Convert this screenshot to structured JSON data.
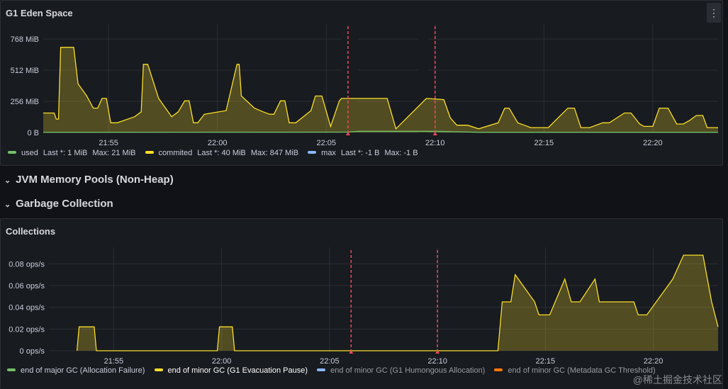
{
  "panels": {
    "eden": {
      "title": "G1 Eden Space",
      "menu_icon": "⋮",
      "legend": [
        {
          "name": "used",
          "color": "#73bf69",
          "last": "Last *: 1 MiB",
          "max": "Max: 21 MiB"
        },
        {
          "name": "commited",
          "color": "#fade2a",
          "last": "Last *: 40 MiB",
          "max": "Max: 847 MiB"
        },
        {
          "name": "max",
          "color": "#8ab8ff",
          "last": "Last *: -1 B",
          "max": "Max: -1 B"
        }
      ]
    },
    "collections": {
      "title": "Collections",
      "legend": [
        {
          "name": "end of major GC (Allocation Failure)",
          "color": "#73bf69"
        },
        {
          "name": "end of minor GC (G1 Evacuation Pause)",
          "color": "#fade2a"
        },
        {
          "name": "end of minor GC (G1 Humongous Allocation)",
          "color": "#8ab8ff"
        },
        {
          "name": "end of minor GC (Metadata GC Threshold)",
          "color": "#ff780a"
        }
      ]
    }
  },
  "rows": {
    "nonheap": {
      "title": "JVM Memory Pools (Non-Heap)",
      "chevron": "⌄"
    },
    "gc": {
      "title": "Garbage Collection",
      "chevron": "⌄"
    }
  },
  "watermark": "@稀土掘金技术社区",
  "chart_data": [
    {
      "type": "area",
      "title": "G1 Eden Space",
      "x_unit": "minutes since 21:52",
      "x_ticks": [
        "21:55",
        "22:00",
        "22:05",
        "22:10",
        "22:15",
        "22:20"
      ],
      "xlim": [
        "21:52",
        "22:23"
      ],
      "y_ticks": [
        "0 B",
        "256 MiB",
        "512 MiB",
        "768 MiB"
      ],
      "y_unit": "MiB",
      "ylim": [
        0,
        850
      ],
      "annotations_x": [
        "22:06",
        "22:10"
      ],
      "fill_between_annotations": "22:06 – 22:10",
      "series": [
        {
          "name": "commited",
          "color": "#fade2a",
          "x": [
            "21:52",
            "21:52:30",
            "21:52:36",
            "21:52:42",
            "21:52:48",
            "21:53:24",
            "21:53:36",
            "21:53:48",
            "21:54",
            "21:54:18",
            "21:54:30",
            "21:54:42",
            "21:54:54",
            "21:55:06",
            "21:55:24",
            "21:56:12",
            "21:56:30",
            "21:56:36",
            "21:56:48",
            "21:57:18",
            "21:57:54",
            "21:58:12",
            "21:58:30",
            "21:58:42",
            "21:58:54",
            "21:59:06",
            "21:59:24",
            "22:00:24",
            "22:00:54",
            "22:01",
            "22:01:06",
            "22:01:42",
            "22:02:06",
            "22:02:24",
            "22:02:36",
            "22:02:54",
            "22:03:06",
            "22:03:18",
            "22:03:36",
            "22:04:18",
            "22:04:30",
            "22:04:48",
            "22:05:12",
            "22:05:36",
            "22:05:42",
            "22:07:48",
            "22:08:12",
            "22:09:36",
            "22:10:24",
            "22:10:42",
            "22:11",
            "22:11:30",
            "22:12",
            "22:12:54",
            "22:13:12",
            "22:13:24",
            "22:13:48",
            "22:14:06",
            "22:14:24",
            "22:15:12",
            "22:16:06",
            "22:16:24",
            "22:16:42",
            "22:17:06",
            "22:17:42",
            "22:18",
            "22:18:42",
            "22:19",
            "22:19:24",
            "22:19:36",
            "22:20",
            "22:20:18",
            "22:20:42",
            "22:21:06",
            "22:21:24",
            "22:21:42",
            "22:22",
            "22:22:18",
            "22:22:30",
            "22:22:48",
            "22:23"
          ],
          "values": [
            160,
            160,
            110,
            110,
            700,
            700,
            400,
            350,
            300,
            200,
            200,
            280,
            280,
            80,
            80,
            130,
            170,
            560,
            560,
            280,
            130,
            170,
            260,
            260,
            80,
            80,
            150,
            180,
            560,
            560,
            300,
            200,
            170,
            150,
            150,
            260,
            260,
            80,
            80,
            180,
            300,
            300,
            50,
            260,
            280,
            280,
            30,
            280,
            270,
            120,
            60,
            60,
            30,
            80,
            200,
            200,
            80,
            60,
            40,
            40,
            200,
            200,
            40,
            40,
            80,
            80,
            160,
            160,
            70,
            50,
            50,
            200,
            200,
            70,
            70,
            100,
            140,
            140,
            40,
            40,
            40
          ]
        },
        {
          "name": "used",
          "color": "#73bf69",
          "x": [
            "21:52",
            "22:06",
            "22:06:30",
            "22:10",
            "22:12",
            "22:23"
          ],
          "values": [
            2,
            3,
            10,
            10,
            2,
            2
          ]
        }
      ]
    },
    {
      "type": "area",
      "title": "Collections",
      "x_unit": "minutes since 21:52",
      "x_ticks": [
        "21:55",
        "22:00",
        "22:05",
        "22:10",
        "22:15",
        "22:20"
      ],
      "xlim": [
        "21:52",
        "22:23"
      ],
      "y_ticks": [
        "0 ops/s",
        "0.02 ops/s",
        "0.04 ops/s",
        "0.06 ops/s",
        "0.08 ops/s"
      ],
      "y_unit": "ops/s",
      "ylim": [
        0,
        0.09
      ],
      "annotations_x": [
        "22:06",
        "22:10"
      ],
      "series": [
        {
          "name": "end of minor GC (G1 Evacuation Pause)",
          "color": "#fade2a",
          "x": [
            "21:53:18",
            "21:53:24",
            "21:54:06",
            "21:54:12",
            "21:59:48",
            "21:59:54",
            "22:00:30",
            "22:00:36",
            "22:12:48",
            "22:13",
            "22:13:24",
            "22:13:36",
            "22:14:30",
            "22:14:42",
            "22:15:12",
            "22:15:54",
            "22:16:12",
            "22:16:36",
            "22:17:18",
            "22:17:30",
            "22:19:06",
            "22:19:18",
            "22:19:42",
            "22:20:54",
            "22:21:24",
            "22:22:18",
            "22:22:42",
            "22:23"
          ],
          "values": [
            0,
            0.022,
            0.022,
            0,
            0,
            0.022,
            0.022,
            0,
            0,
            0.045,
            0.045,
            0.07,
            0.045,
            0.033,
            0.033,
            0.066,
            0.045,
            0.045,
            0.066,
            0.045,
            0.045,
            0.033,
            0.033,
            0.066,
            0.088,
            0.088,
            0.045,
            0.022
          ]
        }
      ]
    }
  ]
}
